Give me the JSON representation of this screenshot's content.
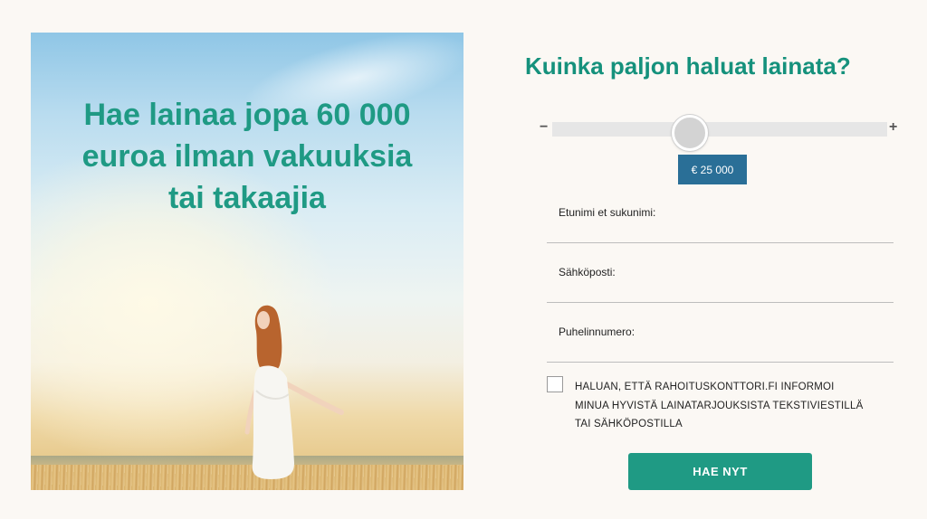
{
  "hero": {
    "heading_line1": "Hae lainaa jopa 60 000",
    "heading_line2": "euroa ilman vakuuksia",
    "heading_line3": "tai takaajia"
  },
  "form": {
    "title": "Kuinka paljon haluat lainata?",
    "slider": {
      "minus_label": "−",
      "plus_label": "+",
      "value_fraction": 0.41,
      "amount_label": "€ 25 000"
    },
    "fields": {
      "name_label": "Etunimi et sukunimi:",
      "name_value": "",
      "email_label": "Sähköposti:",
      "email_value": "",
      "phone_label": "Puhelinnumero:",
      "phone_value": ""
    },
    "consent": {
      "line1": "HALUAN, ETTÄ RAHOITUSKONTTORI.FI INFORMOI",
      "line2": "MINUA HYVISTÄ LAINATARJOUKSISTA TEKSTIVIESTILLÄ",
      "line3": "TAI SÄHKÖPOSTILLA",
      "checked": false
    },
    "submit_label": "HAE NYT"
  },
  "colors": {
    "accent": "#1f9a84",
    "badge": "#2a6f97",
    "background": "#fbf8f4"
  }
}
